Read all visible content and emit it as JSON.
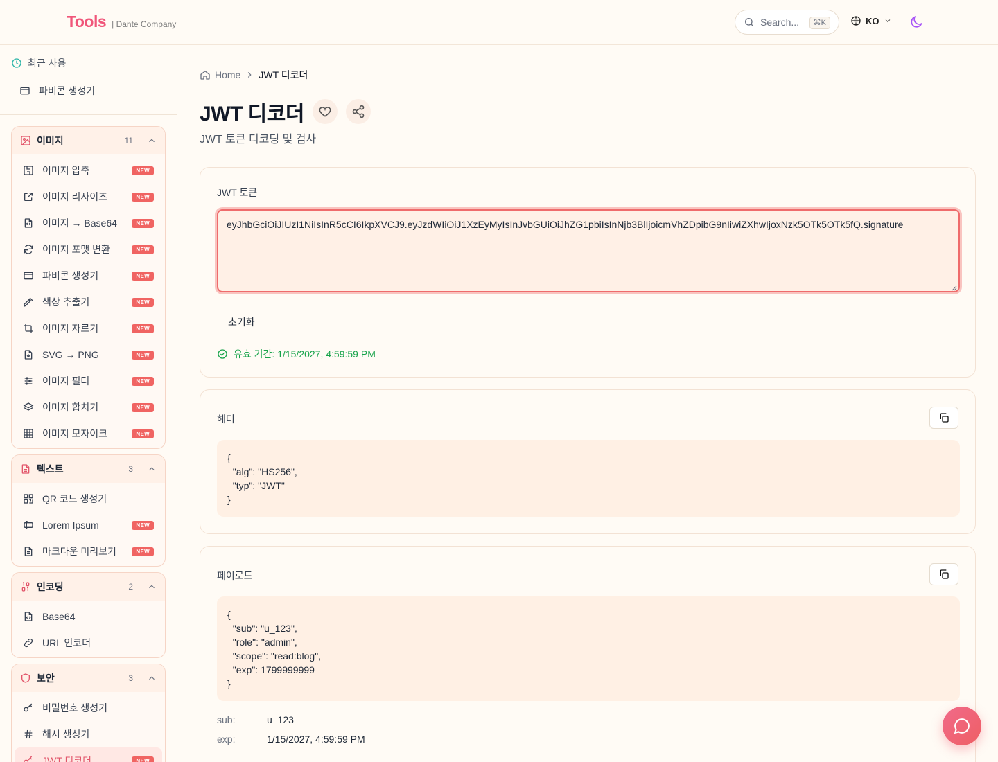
{
  "header": {
    "brand": "Tools",
    "brand_sub": "| Dante Company",
    "search_placeholder": "Search...",
    "search_shortcut": "⌘K",
    "language": "KO"
  },
  "sidebar": {
    "recent_title": "최근 사용",
    "recent_items": [
      "파비콘 생성기"
    ],
    "new_badge": "NEW",
    "groups": [
      {
        "title": "이미지",
        "count": "11",
        "items": [
          {
            "label": "이미지 압축",
            "new": true
          },
          {
            "label": "이미지 리사이즈",
            "new": true
          },
          {
            "label": "이미지 → Base64",
            "new": true
          },
          {
            "label": "이미지 포맷 변환",
            "new": true
          },
          {
            "label": "파비콘 생성기",
            "new": true
          },
          {
            "label": "색상 추출기",
            "new": true
          },
          {
            "label": "이미지 자르기",
            "new": true
          },
          {
            "label": "SVG → PNG",
            "new": true
          },
          {
            "label": "이미지 필터",
            "new": true
          },
          {
            "label": "이미지 합치기",
            "new": true
          },
          {
            "label": "이미지 모자이크",
            "new": true
          }
        ]
      },
      {
        "title": "텍스트",
        "count": "3",
        "items": [
          {
            "label": "QR 코드 생성기",
            "new": false
          },
          {
            "label": "Lorem Ipsum",
            "new": true
          },
          {
            "label": "마크다운 미리보기",
            "new": true
          }
        ]
      },
      {
        "title": "인코딩",
        "count": "2",
        "items": [
          {
            "label": "Base64",
            "new": false
          },
          {
            "label": "URL 인코더",
            "new": false
          }
        ]
      },
      {
        "title": "보안",
        "count": "3",
        "items": [
          {
            "label": "비밀번호 생성기",
            "new": false
          },
          {
            "label": "해시 생성기",
            "new": false
          },
          {
            "label": "JWT 디코더",
            "new": true
          }
        ]
      }
    ]
  },
  "main": {
    "breadcrumb_home": "Home",
    "breadcrumb_current": "JWT 디코더",
    "title": "JWT 디코더",
    "description": "JWT 토큰 디코딩 및 검사",
    "token_label": "JWT 토큰",
    "token_value": "eyJhbGciOiJIUzI1NiIsInR5cCI6IkpXVCJ9.eyJzdWIiOiJ1XzEyMyIsInJvbGUiOiJhZG1pbiIsInNjb3BlIjoicmVhZDpibG9nIiwiZXhwIjoxNzk5OTk5OTk5fQ.signature",
    "reset_label": "초기화",
    "validity": "유효 기간: 1/15/2027, 4:59:59 PM",
    "header_label": "헤더",
    "header_json": "{\n  \"alg\": \"HS256\",\n  \"typ\": \"JWT\"\n}",
    "payload_label": "페이로드",
    "payload_json": "{\n  \"sub\": \"u_123\",\n  \"role\": \"admin\",\n  \"scope\": \"read:blog\",\n  \"exp\": 1799999999\n}",
    "claims": [
      {
        "key": "sub:",
        "value": "u_123"
      },
      {
        "key": "exp:",
        "value": "1/15/2027, 4:59:59 PM"
      }
    ]
  },
  "colors": {
    "brand": "#f0567a",
    "accent": "#ef6b6b",
    "success": "#16a34a",
    "badge": "#f06462"
  }
}
